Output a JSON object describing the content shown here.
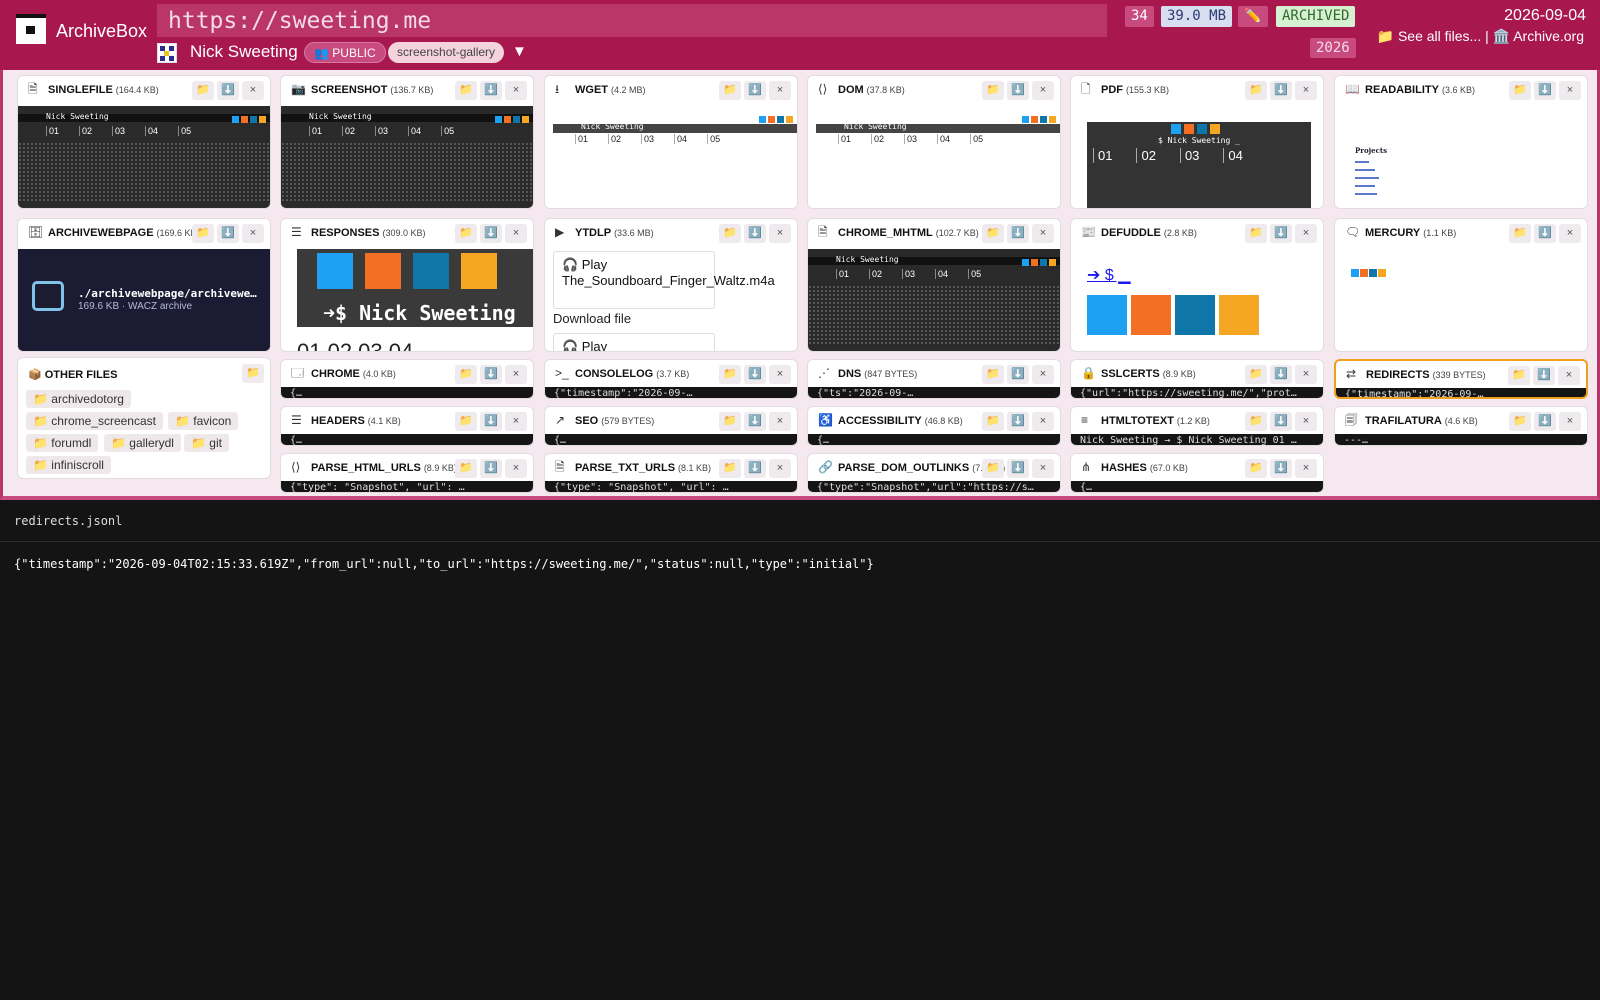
{
  "header": {
    "brand": "ArchiveBox",
    "url": "https://sweeting.me",
    "site_title": "Nick Sweeting",
    "visibility": "👥 PUBLIC",
    "tag": "screenshot-gallery",
    "tag_dropdown": "▼",
    "count": "34",
    "size": "39.0 MB",
    "edit_icon": "✏️",
    "status": "ARCHIVED",
    "year": "2026",
    "date": "2026-09-04",
    "see_all": "📁 See all files...",
    "separator": "|",
    "archive_org": "🏛️ Archive.org"
  },
  "cards": [
    {
      "id": "singlefile",
      "title": "SINGLEFILE",
      "size": "(164.4 KB)",
      "icon": "file-check-icon",
      "glyph": "🗎"
    },
    {
      "id": "screenshot",
      "title": "SCREENSHOT",
      "size": "(136.7 KB)",
      "icon": "camera-icon",
      "glyph": "📷"
    },
    {
      "id": "wget",
      "title": "WGET",
      "size": "(4.2 MB)",
      "icon": "download-icon",
      "glyph": "⭳"
    },
    {
      "id": "dom",
      "title": "DOM",
      "size": "(37.8 KB)",
      "icon": "code-icon",
      "glyph": "⟨⟩"
    },
    {
      "id": "pdf",
      "title": "PDF",
      "size": "(155.3 KB)",
      "icon": "file-icon",
      "glyph": "🗋"
    },
    {
      "id": "readability",
      "title": "READABILITY",
      "size": "(3.6 KB)",
      "icon": "book-icon",
      "glyph": "📖"
    },
    {
      "id": "archivewebpage",
      "title": "ARCHIVEWEBPAGE",
      "size": "(169.6 KB)",
      "icon": "archive-icon",
      "glyph": "🗄"
    },
    {
      "id": "responses",
      "title": "RESPONSES",
      "size": "(309.0 KB)",
      "icon": "database-icon",
      "glyph": "☰"
    },
    {
      "id": "ytdlp",
      "title": "YTDLP",
      "size": "(33.6 MB)",
      "icon": "video-icon",
      "glyph": "▶"
    },
    {
      "id": "chrome_mhtml",
      "title": "CHROME_MHTML",
      "size": "(102.7 KB)",
      "icon": "file-text-icon",
      "glyph": "🗎"
    },
    {
      "id": "defuddle",
      "title": "DEFUDDLE",
      "size": "(2.8 KB)",
      "icon": "newspaper-icon",
      "glyph": "📰"
    },
    {
      "id": "mercury",
      "title": "MERCURY",
      "size": "(1.1 KB)",
      "icon": "message-icon",
      "glyph": "🗨"
    }
  ],
  "strips": [
    {
      "id": "chrome",
      "title": "CHROME",
      "size": "(4.0 KB)",
      "icon": "browser-icon",
      "glyph": "🗔",
      "content": "{…"
    },
    {
      "id": "consolelog",
      "title": "CONSOLELOG",
      "size": "(3.7 KB)",
      "icon": "terminal-icon",
      "glyph": ">_",
      "content": "{\"timestamp\":\"2026-09-…"
    },
    {
      "id": "dns",
      "title": "DNS",
      "size": "(847 BYTES)",
      "icon": "share-icon",
      "glyph": "⋰",
      "content": "{\"ts\":\"2026-09-…"
    },
    {
      "id": "sslcerts",
      "title": "SSLCERTS",
      "size": "(8.9 KB)",
      "icon": "lock-icon",
      "glyph": "🔒",
      "content": "{\"url\":\"https://sweeting.me/\",\"prot…"
    },
    {
      "id": "redirects",
      "title": "REDIRECTS",
      "size": "(339 BYTES)",
      "icon": "arrows-icon",
      "glyph": "⇄",
      "content": "{\"timestamp\":\"2026-09-…"
    },
    {
      "id": "headers",
      "title": "HEADERS",
      "size": "(4.1 KB)",
      "icon": "list-icon",
      "glyph": "☰",
      "content": "{…"
    },
    {
      "id": "seo",
      "title": "SEO",
      "size": "(579 BYTES)",
      "icon": "trending-icon",
      "glyph": "↗",
      "content": "{…"
    },
    {
      "id": "accessibility",
      "title": "ACCESSIBILITY",
      "size": "(46.8 KB)",
      "icon": "accessibility-icon",
      "glyph": "♿",
      "content": "{…"
    },
    {
      "id": "htmltotext",
      "title": "HTMLTOTEXT",
      "size": "(1.2 KB)",
      "icon": "text-icon",
      "glyph": "≡",
      "content": "Nick Sweeting → $ Nick Sweeting 01 …"
    },
    {
      "id": "trafilatura",
      "title": "TRAFILATURA",
      "size": "(4.6 KB)",
      "icon": "reader-icon",
      "glyph": "🗐",
      "content": "---…"
    },
    {
      "id": "parse_html_urls",
      "title": "PARSE_HTML_URLS",
      "size": "(8.9 KB)",
      "icon": "code-icon",
      "glyph": "⟨⟩",
      "content": "{\"type\": \"Snapshot\", \"url\": …"
    },
    {
      "id": "parse_txt_urls",
      "title": "PARSE_TXT_URLS",
      "size": "(8.1 KB)",
      "icon": "file-text-icon",
      "glyph": "🗎",
      "content": "{\"type\": \"Snapshot\", \"url\": …"
    },
    {
      "id": "parse_dom_outlinks",
      "title": "PARSE_DOM_OUTLINKS",
      "size": "(7.4 KB)",
      "icon": "link-icon",
      "glyph": "🔗",
      "content": "{\"type\":\"Snapshot\",\"url\":\"https://s…"
    },
    {
      "id": "hashes",
      "title": "HASHES",
      "size": "(67.0 KB)",
      "icon": "hash-tree-icon",
      "glyph": "⋔",
      "content": "{…"
    }
  ],
  "actions": {
    "open": "📁",
    "download": "⬇️",
    "close": "×"
  },
  "previews": {
    "mini_title": "Nick Sweeting",
    "mini_cols": [
      "01",
      "02",
      "03",
      "04",
      "05"
    ],
    "pdf_cols": [
      "01",
      "02",
      "03",
      "04"
    ],
    "pdf_title": "$ Nick Sweeting _",
    "responses_title": "➜$ Nick Sweeting",
    "responses_numbers": "01  02  03  04",
    "archivewebpage_path": "./archivewebpage/archivewe…",
    "archivewebpage_meta": "169.6 KB · WACZ archive",
    "ytdlp_play1": "🎧 Play The_Soundboard_Finger_Waltz.m4a",
    "ytdlp_download": "Download file",
    "ytdlp_play2": "🎧 Play",
    "defuddle_prompt": "➔ $ ▁",
    "readability_heading": "Projects"
  },
  "other_files": {
    "title": "📦 OTHER FILES",
    "open": "📁",
    "folders": [
      "📁 archivedotorg",
      "📁 chrome_screencast",
      "📁 favicon",
      "📁 forumdl",
      "📁 gallerydl",
      "📁 git",
      "📁 infiniscroll"
    ]
  },
  "viewer": {
    "filename": "redirects.jsonl",
    "content": "{\"timestamp\":\"2026-09-04T02:15:33.619Z\",\"from_url\":null,\"to_url\":\"https://sweeting.me/\",\"status\":null,\"type\":\"initial\"}"
  },
  "colors": {
    "header": "#a8184f",
    "accent": "#c94a7f",
    "selected_border": "#f0a020",
    "twitter": "#1da1f2",
    "soundcloud": "#f26f23",
    "linkedin": "#0e76a8",
    "github": "#f5a623"
  }
}
